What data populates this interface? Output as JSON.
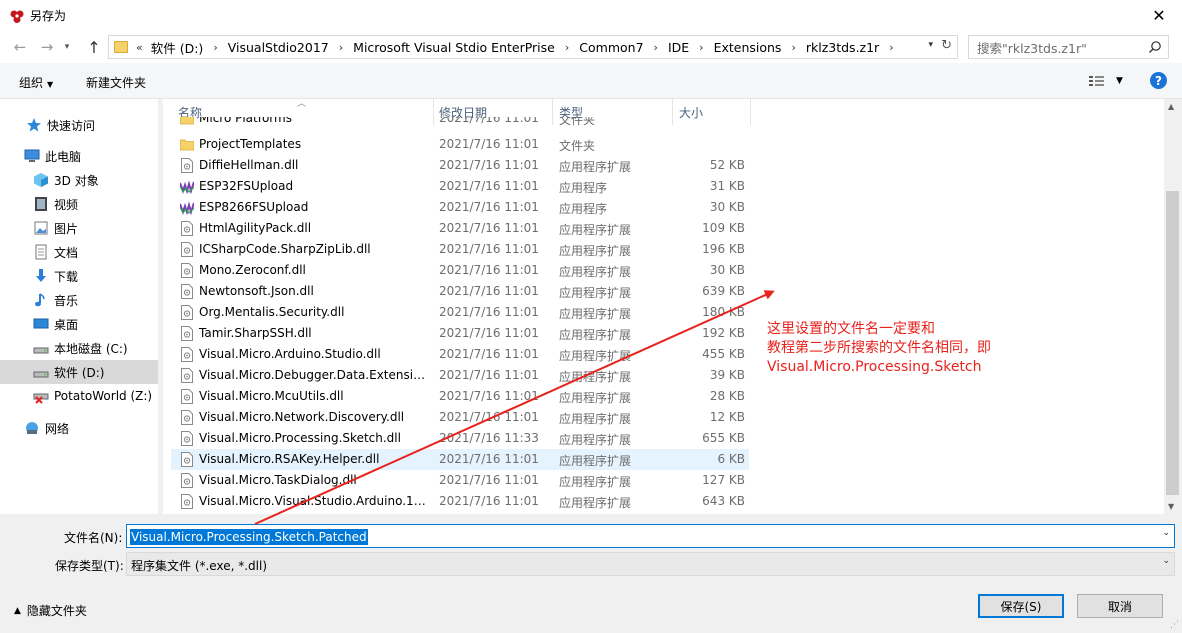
{
  "window": {
    "title": "另存为",
    "close": "✕"
  },
  "nav": {
    "back": "←",
    "forward": "→",
    "up": "↑",
    "breadcrumb_lead": "«",
    "breadcrumbs": [
      "软件 (D:)",
      "VisualStdio2017",
      "Microsoft Visual Stdio EnterPrise",
      "Common7",
      "IDE",
      "Extensions",
      "rklz3tds.z1r"
    ],
    "search_placeholder": "搜索\"rklz3tds.z1r\""
  },
  "toolbar": {
    "organize": "组织",
    "new_folder": "新建文件夹",
    "help": "?"
  },
  "sidebar": {
    "items": [
      {
        "label": "快速访问",
        "icon": "star-icon"
      },
      {
        "label": "此电脑",
        "icon": "pc-icon"
      },
      {
        "label": "3D 对象",
        "icon": "cube-icon"
      },
      {
        "label": "视频",
        "icon": "video-icon"
      },
      {
        "label": "图片",
        "icon": "pictures-icon"
      },
      {
        "label": "文档",
        "icon": "documents-icon"
      },
      {
        "label": "下载",
        "icon": "download-icon"
      },
      {
        "label": "音乐",
        "icon": "music-icon"
      },
      {
        "label": "桌面",
        "icon": "desktop-icon"
      },
      {
        "label": "本地磁盘 (C:)",
        "icon": "drive-icon"
      },
      {
        "label": "软件 (D:)",
        "icon": "drive-icon"
      },
      {
        "label": "PotatoWorld (Z:)",
        "icon": "network-drive-icon"
      },
      {
        "label": "网络",
        "icon": "network-icon"
      }
    ]
  },
  "columns": {
    "name": "名称",
    "date": "修改日期",
    "type": "类型",
    "size": "大小"
  },
  "files": [
    {
      "name": "Micro Platforms",
      "date": "2021/7/16 11:01",
      "type": "文件夹",
      "size": "",
      "icon": "folder-icon"
    },
    {
      "name": "ProjectTemplates",
      "date": "2021/7/16 11:01",
      "type": "文件夹",
      "size": "",
      "icon": "folder-icon"
    },
    {
      "name": "DiffieHellman.dll",
      "date": "2021/7/16 11:01",
      "type": "应用程序扩展",
      "size": "52 KB",
      "icon": "dll-icon"
    },
    {
      "name": "ESP32FSUpload",
      "date": "2021/7/16 11:01",
      "type": "应用程序",
      "size": "31 KB",
      "icon": "exe-icon"
    },
    {
      "name": "ESP8266FSUpload",
      "date": "2021/7/16 11:01",
      "type": "应用程序",
      "size": "30 KB",
      "icon": "exe-icon"
    },
    {
      "name": "HtmlAgilityPack.dll",
      "date": "2021/7/16 11:01",
      "type": "应用程序扩展",
      "size": "109 KB",
      "icon": "dll-icon"
    },
    {
      "name": "ICSharpCode.SharpZipLib.dll",
      "date": "2021/7/16 11:01",
      "type": "应用程序扩展",
      "size": "196 KB",
      "icon": "dll-icon"
    },
    {
      "name": "Mono.Zeroconf.dll",
      "date": "2021/7/16 11:01",
      "type": "应用程序扩展",
      "size": "30 KB",
      "icon": "dll-icon"
    },
    {
      "name": "Newtonsoft.Json.dll",
      "date": "2021/7/16 11:01",
      "type": "应用程序扩展",
      "size": "639 KB",
      "icon": "dll-icon"
    },
    {
      "name": "Org.Mentalis.Security.dll",
      "date": "2021/7/16 11:01",
      "type": "应用程序扩展",
      "size": "180 KB",
      "icon": "dll-icon"
    },
    {
      "name": "Tamir.SharpSSH.dll",
      "date": "2021/7/16 11:01",
      "type": "应用程序扩展",
      "size": "192 KB",
      "icon": "dll-icon"
    },
    {
      "name": "Visual.Micro.Arduino.Studio.dll",
      "date": "2021/7/16 11:01",
      "type": "应用程序扩展",
      "size": "455 KB",
      "icon": "dll-icon"
    },
    {
      "name": "Visual.Micro.Debugger.Data.Extensio...",
      "date": "2021/7/16 11:01",
      "type": "应用程序扩展",
      "size": "39 KB",
      "icon": "dll-icon"
    },
    {
      "name": "Visual.Micro.McuUtils.dll",
      "date": "2021/7/16 11:01",
      "type": "应用程序扩展",
      "size": "28 KB",
      "icon": "dll-icon"
    },
    {
      "name": "Visual.Micro.Network.Discovery.dll",
      "date": "2021/7/16 11:01",
      "type": "应用程序扩展",
      "size": "12 KB",
      "icon": "dll-icon"
    },
    {
      "name": "Visual.Micro.Processing.Sketch.dll",
      "date": "2021/7/16 11:33",
      "type": "应用程序扩展",
      "size": "655 KB",
      "icon": "dll-icon"
    },
    {
      "name": "Visual.Micro.RSAKey.Helper.dll",
      "date": "2021/7/16 11:01",
      "type": "应用程序扩展",
      "size": "6 KB",
      "icon": "dll-icon",
      "highlighted": true
    },
    {
      "name": "Visual.Micro.TaskDialog.dll",
      "date": "2021/7/16 11:01",
      "type": "应用程序扩展",
      "size": "127 KB",
      "icon": "dll-icon"
    },
    {
      "name": "Visual.Micro.Visual.Studio.Arduino.15...",
      "date": "2021/7/16 11:01",
      "type": "应用程序扩展",
      "size": "643 KB",
      "icon": "dll-icon"
    }
  ],
  "form": {
    "filename_label": "文件名(N):",
    "filename_value": "Visual.Micro.Processing.Sketch.Patched",
    "filetype_label": "保存类型(T):",
    "filetype_value": "程序集文件 (*.exe, *.dll)",
    "hide_folders": "隐藏文件夹",
    "save": "保存(S)",
    "cancel": "取消"
  },
  "annotation": {
    "lines": [
      "这里设置的文件名一定要和",
      "教程第二步所搜索的文件名相同，即",
      "Visual.Micro.Processing.Sketch"
    ],
    "color": "#e8221c"
  }
}
